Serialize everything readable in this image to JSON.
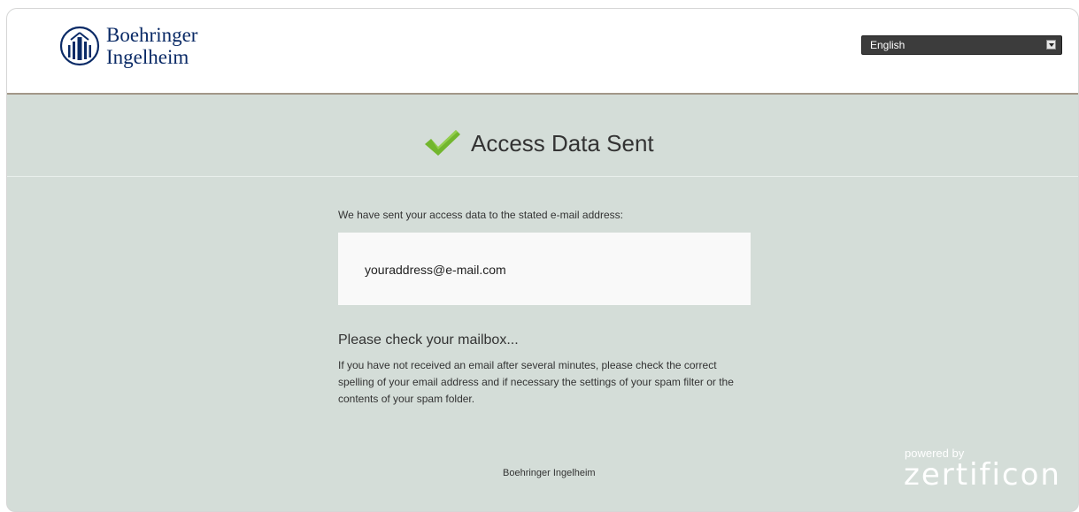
{
  "header": {
    "logo_line1": "Boehringer",
    "logo_line2": "Ingelheim",
    "language_selected": "English"
  },
  "title": {
    "text": "Access Data Sent"
  },
  "content": {
    "intro": "We have sent your access data to the stated e-mail address:",
    "email": "youraddress@e-mail.com",
    "check_heading": "Please check your mailbox...",
    "help_text": "If you have not received an email after several minutes, please check the correct spelling of your email address and if necessary the settings of your spam filter or the contents of your spam folder."
  },
  "footer": {
    "company": "Boehringer Ingelheim",
    "powered_by": "powered by",
    "brand": "zertificon"
  },
  "colors": {
    "accent_green": "#72b62e",
    "brand_navy": "#0a2a66",
    "background": "#d4ddd8",
    "header_rule": "#a29889"
  },
  "icons": [
    "boehringer-logo-icon",
    "checkmark-icon",
    "dropdown-arrow-icon"
  ]
}
